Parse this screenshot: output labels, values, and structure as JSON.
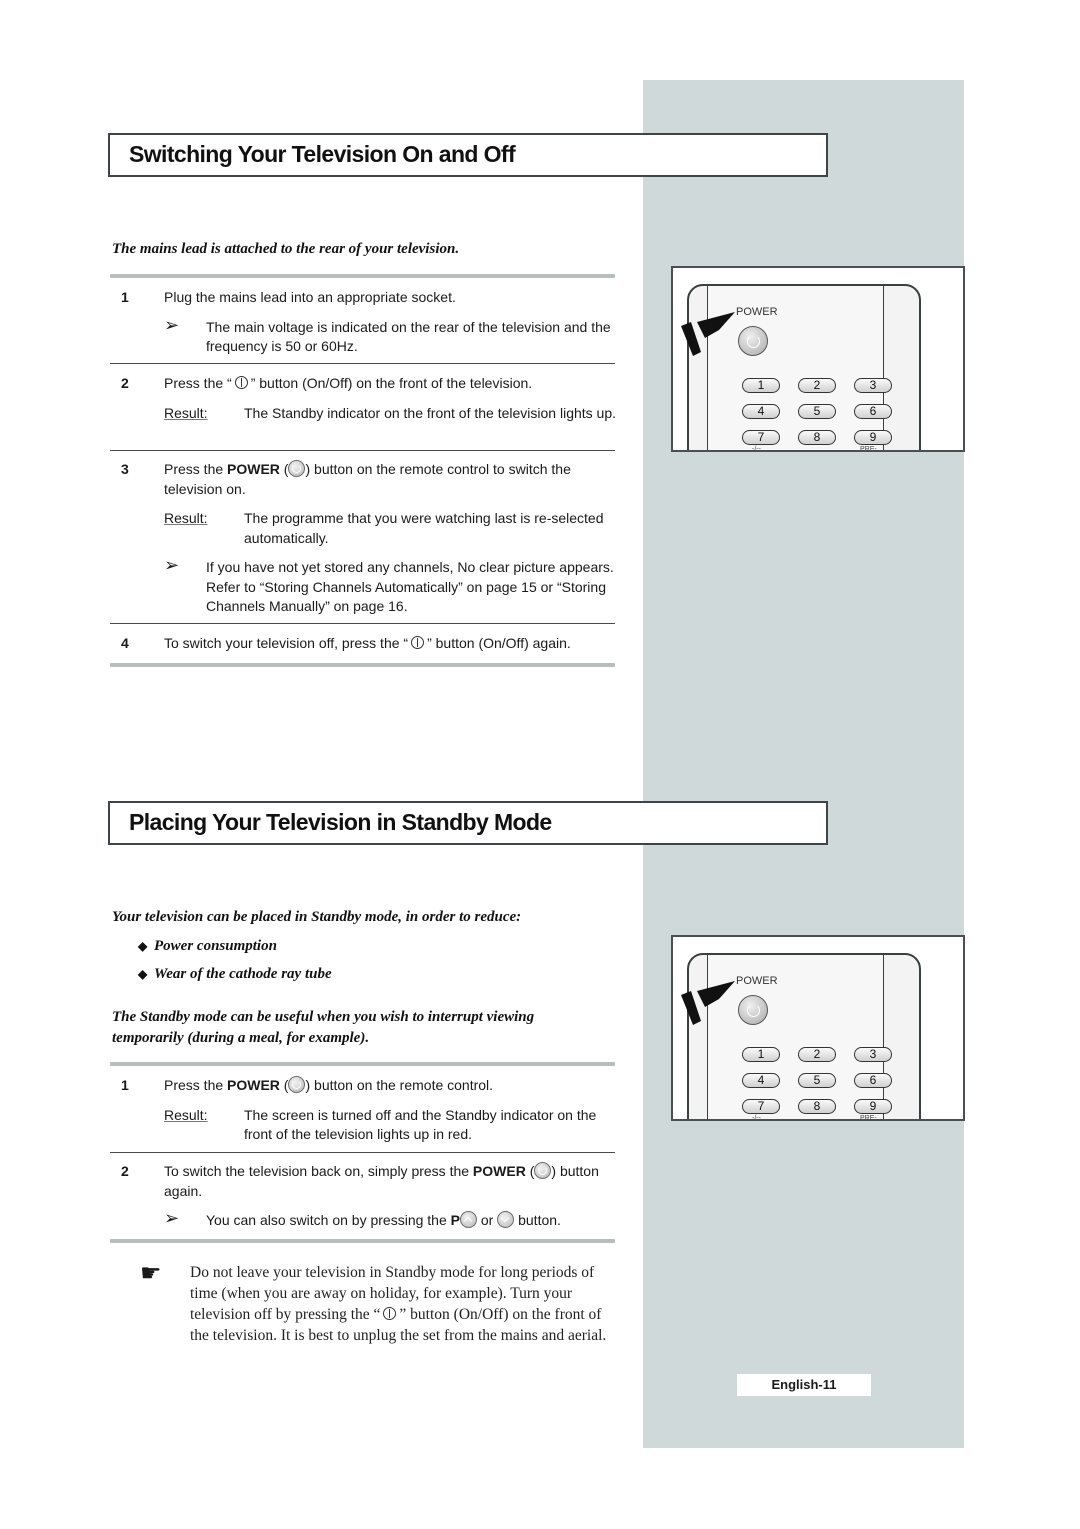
{
  "section1": {
    "title": "Switching Your Television On and Off",
    "intro": "The mains lead is attached to the rear of your television.",
    "steps": [
      {
        "num": "1",
        "text": "Plug the mains lead into an appropriate socket.",
        "note": "The main voltage is indicated on the rear of the television and the frequency is 50 or 60Hz."
      },
      {
        "num": "2",
        "text_pre": "Press the “",
        "text_post": "” button (On/Off) on the front of the television.",
        "result_label": "Result:",
        "result": "The Standby indicator on the front of the television lights up."
      },
      {
        "num": "3",
        "text_pre": "Press the ",
        "text_bold": "POWER",
        "text_post": " button on the remote control to switch the television on.",
        "result_label": "Result:",
        "result": "The programme that you were watching last is re-selected automatically.",
        "note": "If you have not yet stored any channels, No clear picture appears. Refer to “Storing Channels Automatically” on page 15 or “Storing Channels Manually” on page 16."
      },
      {
        "num": "4",
        "text_pre": "To switch your television off, press the “",
        "text_post": "” button (On/Off) again."
      }
    ]
  },
  "section2": {
    "title": "Placing Your Television in Standby Mode",
    "intro": "Your television can be placed in Standby mode, in order to reduce:",
    "bullets": [
      "Power consumption",
      "Wear of the cathode ray tube"
    ],
    "intro2": "The Standby mode can be useful when you wish to interrupt viewing temporarily (during a meal, for example).",
    "steps": [
      {
        "num": "1",
        "text_pre": "Press the ",
        "text_bold": "POWER",
        "text_post": " button on the remote control.",
        "result_label": "Result:",
        "result": "The screen is turned off and the Standby indicator on the front of the television lights up in red."
      },
      {
        "num": "2",
        "text_pre": "To switch the television back on, simply press the ",
        "text_bold": "POWER",
        "text_post": " button again.",
        "note_pre": "You can also switch on by pressing the ",
        "note_bold": "P",
        "note_mid": " or ",
        "note_post": " button."
      }
    ],
    "warning_pre": "Do not leave your television in Standby mode for long periods of time (when you are away on holiday, for example). Turn your television off by pressing the “",
    "warning_post": "” button (On/Off) on the front of the television. It is best to unplug the set from the mains and aerial."
  },
  "remote": {
    "power_label": "POWER",
    "keys": [
      "1",
      "2",
      "3",
      "4",
      "5",
      "6",
      "7",
      "8",
      "9"
    ],
    "sub_labels": [
      "-/--",
      "PRE-CH"
    ]
  },
  "footer": {
    "page_label": "English-11"
  },
  "colors": {
    "sidebar": "#d0d9d9",
    "title_border": "#3e444a",
    "rule": "#b7bebe"
  }
}
